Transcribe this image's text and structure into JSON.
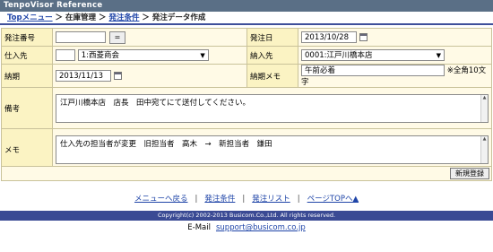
{
  "app_title": "TenpoVisor Reference",
  "breadcrumb": {
    "top": "Topメニュー",
    "sep1": " ＞ ",
    "inventory": "在庫管理",
    "sep2": " ＞ ",
    "order_terms": "発注条件",
    "sep3": " ＞ ",
    "current": "発注データ作成"
  },
  "form": {
    "order_no_label": "発注番号",
    "order_no_value": "",
    "eq_button": "=",
    "order_date_label": "発注日",
    "order_date_value": "2013/10/28",
    "supplier_label": "仕入先",
    "supplier_code": "",
    "supplier_name": "1:西菱商会",
    "delivery_to_label": "納入先",
    "delivery_to_value": "0001:江戸川橋本店",
    "due_label": "納期",
    "due_value": "2013/11/13",
    "due_memo_label": "納期メモ",
    "due_memo_value": "午前必着",
    "due_memo_note": "※全角10文字",
    "remarks_label": "備考",
    "remarks_value": "江戸川橋本店　店長　田中宛てにて送付してください。",
    "memo_label": "メモ",
    "memo_value": "仕入先の担当者が変更　旧担当者　高木　→　新担当者　鎌田",
    "register_button": "新規登録"
  },
  "footer": {
    "links": [
      "メニューへ戻る",
      "発注条件",
      "発注リスト",
      "ページTOPへ▲"
    ],
    "separator": "|",
    "copyright": "Copyright(c) 2002-2013 Busicom.Co.,Ltd. All rights reserved.",
    "email_label": "E-Mail",
    "email": "support@busicom.co.jp"
  }
}
